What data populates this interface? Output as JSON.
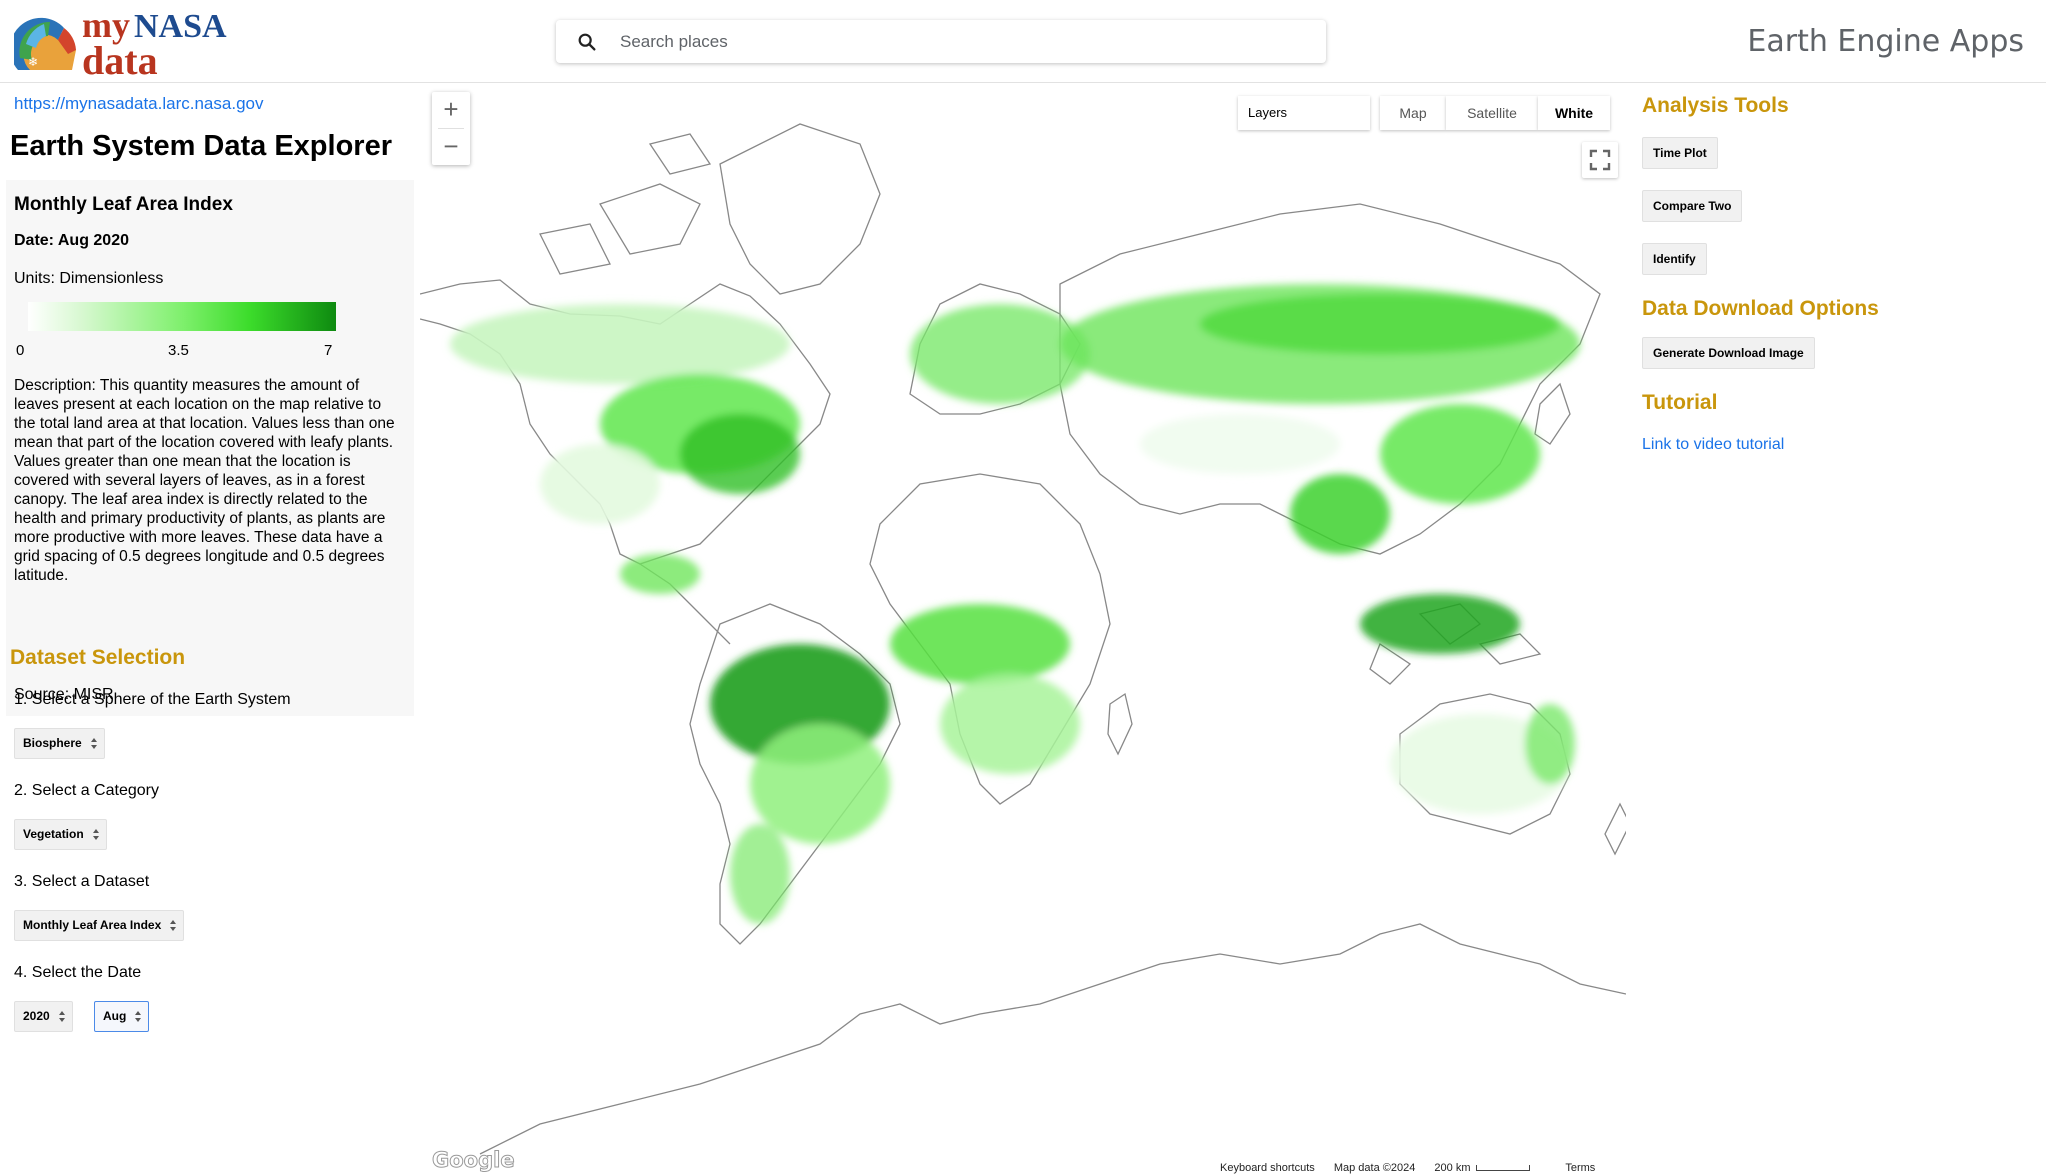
{
  "header": {
    "logo_line1_a": "my",
    "logo_line1_b": "NASA",
    "logo_line2": "data",
    "search_placeholder": "Search places",
    "brand": "Earth Engine Apps"
  },
  "left_panel": {
    "site_link": "https://mynasadata.larc.nasa.gov",
    "app_title": "Earth System Data Explorer",
    "dataset_card": {
      "title": "Monthly Leaf Area Index",
      "date": "Date: Aug 2020",
      "units": "Units: Dimensionless",
      "legend": {
        "min": "0",
        "mid": "3.5",
        "max": "7",
        "colors": [
          "#ffffff",
          "#d6f8cf",
          "#7ff06d",
          "#3cdc2b",
          "#0e8a10"
        ]
      },
      "description": "Description: This quantity measures the amount of leaves present at each location on the map relative to the total land area at that location. Values less than one mean that part of the location covered with leafy plants. Values greater than one mean that the location is covered with several layers of leaves, as in a forest canopy. The leaf area index is directly related to the health and primary productivity of plants, as plants are more productive with more leaves. These data have a grid spacing of 0.5 degrees longitude and 0.5 degrees latitude.",
      "source": "Source: MISR"
    },
    "dataset_selection": {
      "title": "Dataset Selection",
      "step1_label": "1. Select a Sphere of the Earth System",
      "step1_value": "Biosphere",
      "step2_label": "2. Select a Category",
      "step2_value": "Vegetation",
      "step3_label": "3. Select a Dataset",
      "step3_value": "Monthly Leaf Area Index",
      "step4_label": "4. Select the Date",
      "year_value": "2020",
      "month_value": "Aug"
    }
  },
  "map": {
    "zoom_in": "+",
    "zoom_out": "−",
    "layers_label": "Layers",
    "map_types": [
      "Map",
      "Satellite",
      "White"
    ],
    "active_map_type": "White",
    "google_logo": "Google",
    "attribution": {
      "shortcuts": "Keyboard shortcuts",
      "map_data": "Map data ©2024",
      "scale": "200 km",
      "terms": "Terms"
    }
  },
  "right_panel": {
    "analysis_title": "Analysis Tools",
    "time_plot": "Time Plot",
    "compare_two": "Compare Two",
    "identify": "Identify",
    "download_title": "Data Download Options",
    "generate_download": "Generate Download Image",
    "tutorial_title": "Tutorial",
    "tutorial_link": "Link to video tutorial"
  },
  "colors": {
    "section_title": "#c9960c",
    "link": "#1a73e8",
    "logo_red": "#b8351f",
    "logo_blue": "#1e4b8f"
  }
}
